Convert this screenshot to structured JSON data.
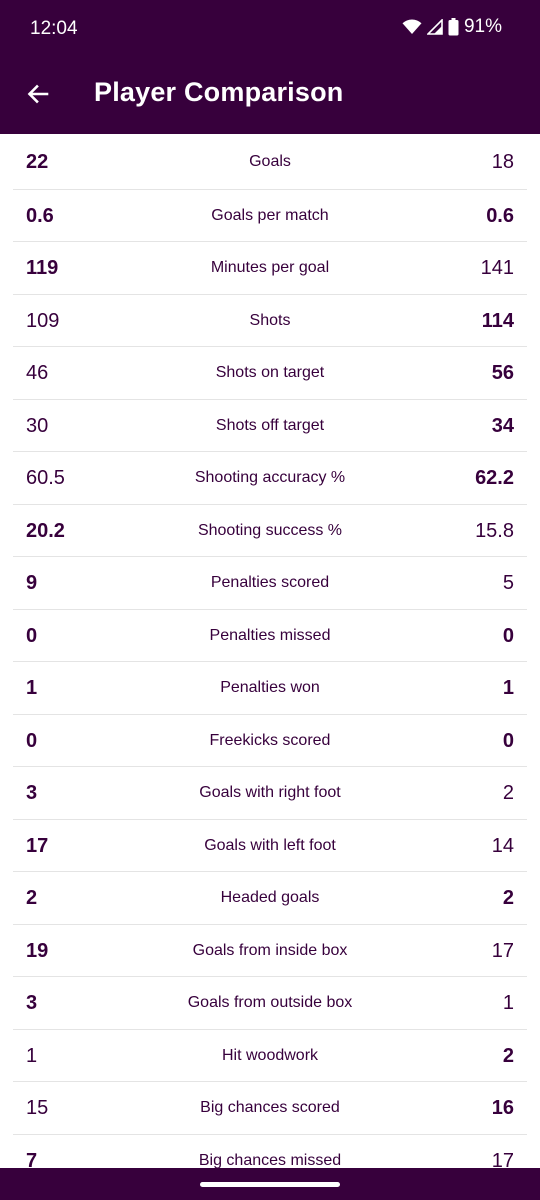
{
  "status": {
    "time": "12:04",
    "battery": "91%"
  },
  "header": {
    "title": "Player Comparison"
  },
  "stats": [
    {
      "label": "Goals",
      "left": "22",
      "right": "18",
      "left_bold": true,
      "right_bold": false
    },
    {
      "label": "Goals per match",
      "left": "0.6",
      "right": "0.6",
      "left_bold": true,
      "right_bold": true
    },
    {
      "label": "Minutes per goal",
      "left": "119",
      "right": "141",
      "left_bold": true,
      "right_bold": false
    },
    {
      "label": "Shots",
      "left": "109",
      "right": "114",
      "left_bold": false,
      "right_bold": true
    },
    {
      "label": "Shots on target",
      "left": "46",
      "right": "56",
      "left_bold": false,
      "right_bold": true
    },
    {
      "label": "Shots off target",
      "left": "30",
      "right": "34",
      "left_bold": false,
      "right_bold": true
    },
    {
      "label": "Shooting accuracy %",
      "left": "60.5",
      "right": "62.2",
      "left_bold": false,
      "right_bold": true
    },
    {
      "label": "Shooting success %",
      "left": "20.2",
      "right": "15.8",
      "left_bold": true,
      "right_bold": false
    },
    {
      "label": "Penalties scored",
      "left": "9",
      "right": "5",
      "left_bold": true,
      "right_bold": false
    },
    {
      "label": "Penalties missed",
      "left": "0",
      "right": "0",
      "left_bold": true,
      "right_bold": true
    },
    {
      "label": "Penalties won",
      "left": "1",
      "right": "1",
      "left_bold": true,
      "right_bold": true
    },
    {
      "label": "Freekicks scored",
      "left": "0",
      "right": "0",
      "left_bold": true,
      "right_bold": true
    },
    {
      "label": "Goals with right foot",
      "left": "3",
      "right": "2",
      "left_bold": true,
      "right_bold": false
    },
    {
      "label": "Goals with left foot",
      "left": "17",
      "right": "14",
      "left_bold": true,
      "right_bold": false
    },
    {
      "label": "Headed goals",
      "left": "2",
      "right": "2",
      "left_bold": true,
      "right_bold": true
    },
    {
      "label": "Goals from inside box",
      "left": "19",
      "right": "17",
      "left_bold": true,
      "right_bold": false
    },
    {
      "label": "Goals from outside box",
      "left": "3",
      "right": "1",
      "left_bold": true,
      "right_bold": false
    },
    {
      "label": "Hit woodwork",
      "left": "1",
      "right": "2",
      "left_bold": false,
      "right_bold": true
    },
    {
      "label": "Big chances scored",
      "left": "15",
      "right": "16",
      "left_bold": false,
      "right_bold": true
    },
    {
      "label": "Big chances missed",
      "left": "7",
      "right": "17",
      "left_bold": true,
      "right_bold": false
    }
  ],
  "theme": {
    "brand": "#37003c"
  },
  "icons": {
    "back": "arrow-back-icon",
    "wifi": "wifi-icon",
    "signal": "signal-icon",
    "battery": "battery-icon"
  }
}
